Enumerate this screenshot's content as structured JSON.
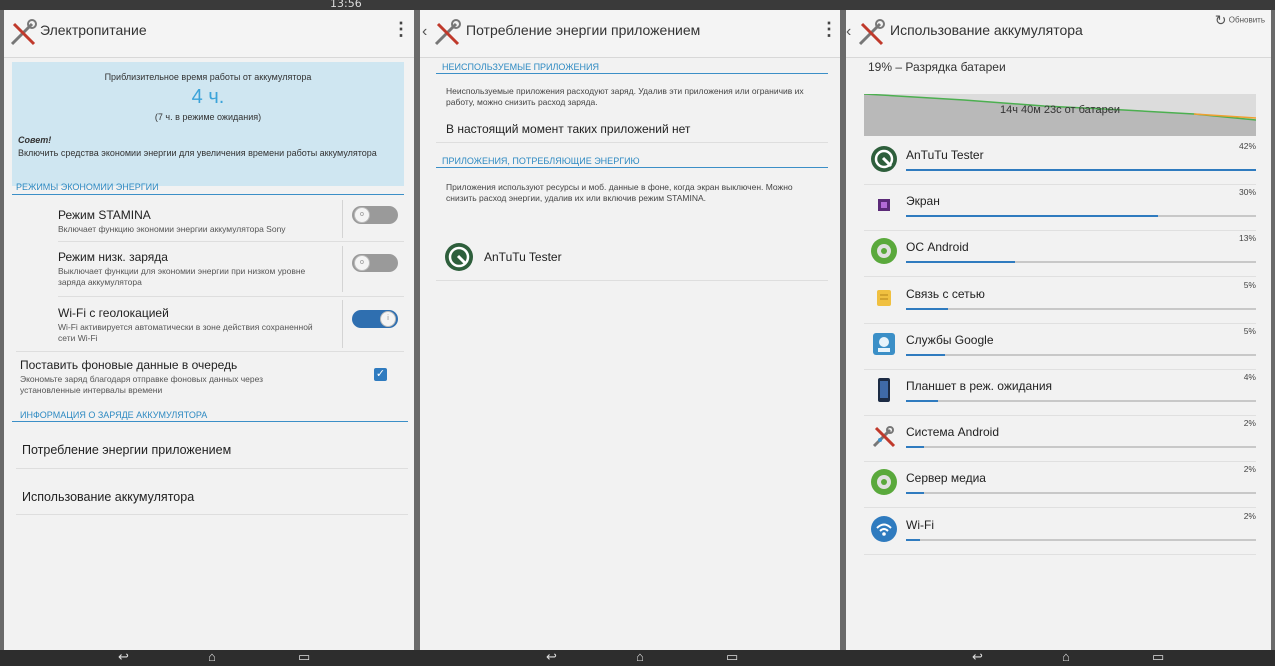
{
  "status": {
    "time": "13:56"
  },
  "panel1": {
    "title": "Электропитание",
    "battery": {
      "label": "Приблизительное время работы от аккумулятора",
      "hours": "4 ч.",
      "standby": "(7 ч. в режиме ожидания)",
      "tip_heading": "Совет!",
      "tip_text": "Включить средства экономии энергии для увеличения времени работы аккумулятора"
    },
    "modes_section": "Режимы экономии энергии",
    "stamina": {
      "title": "Режим STAMINA",
      "desc": "Включает функцию экономии энергии аккумулятора Sony",
      "on": false
    },
    "lowbatt": {
      "title": "Режим низк. заряда",
      "desc": "Выключает функции для экономии энергии при низком уровне заряда аккумулятора",
      "on": false
    },
    "wifi_geo": {
      "title": "Wi-Fi с геолокацией",
      "desc": "Wi-Fi активируется автоматически в зоне действия сохраненной сети Wi-Fi",
      "on": true
    },
    "queue": {
      "title": "Поставить фоновые данные в очередь",
      "desc": "Экономьте заряд благодаря отправке фоновых данных через установленные интервалы времени",
      "checked": true
    },
    "info_section": "Информация о заряде аккумулятора",
    "link_apps": "Потребление энергии приложением",
    "link_usage": "Использование аккумулятора"
  },
  "panel2": {
    "title": "Потребление энергии приложением",
    "unused_section": "Неиспользуемые приложения",
    "unused_desc": "Неиспользуемые приложения расходуют заряд. Удалив эти приложения или ограничив их работу, можно снизить расход заряда.",
    "unused_none": "В настоящий момент таких приложений нет",
    "consuming_section": "Приложения, потребляющие энергию",
    "consuming_desc": "Приложения используют ресурсы и моб. данные в фоне, когда экран выключен. Можно снизить расход энергии, удалив их или включив режим STAMINA.",
    "app_name": "AnTuTu Tester"
  },
  "panel3": {
    "title": "Использование аккумулятора",
    "refresh_label": "Обновить",
    "battery_status": "19% – Разрядка батареи",
    "graph_label": "14ч 40м 23с от батареи",
    "items": [
      {
        "name": "AnTuTu Tester",
        "pct_label": "42%",
        "pct": 100
      },
      {
        "name": "Экран",
        "pct_label": "30%",
        "pct": 72
      },
      {
        "name": "ОС Android",
        "pct_label": "13%",
        "pct": 31
      },
      {
        "name": "Связь с сетью",
        "pct_label": "5%",
        "pct": 12
      },
      {
        "name": "Службы Google",
        "pct_label": "5%",
        "pct": 11
      },
      {
        "name": "Планшет в реж. ожидания",
        "pct_label": "4%",
        "pct": 9
      },
      {
        "name": "Система Android",
        "pct_label": "2%",
        "pct": 5
      },
      {
        "name": "Сервер медиа",
        "pct_label": "2%",
        "pct": 5
      },
      {
        "name": "Wi-Fi",
        "pct_label": "2%",
        "pct": 4
      }
    ]
  },
  "icons": {
    "settings": "tools-icon",
    "back": "chevron-left-icon",
    "overflow": "overflow-menu-icon",
    "refresh": "refresh-icon",
    "nav_back": "back-icon",
    "nav_home": "home-icon",
    "nav_recents": "recents-icon"
  },
  "colors": {
    "accent": "#2f7bbf",
    "section": "#2e8ac2",
    "card": "#cfe6f1"
  }
}
